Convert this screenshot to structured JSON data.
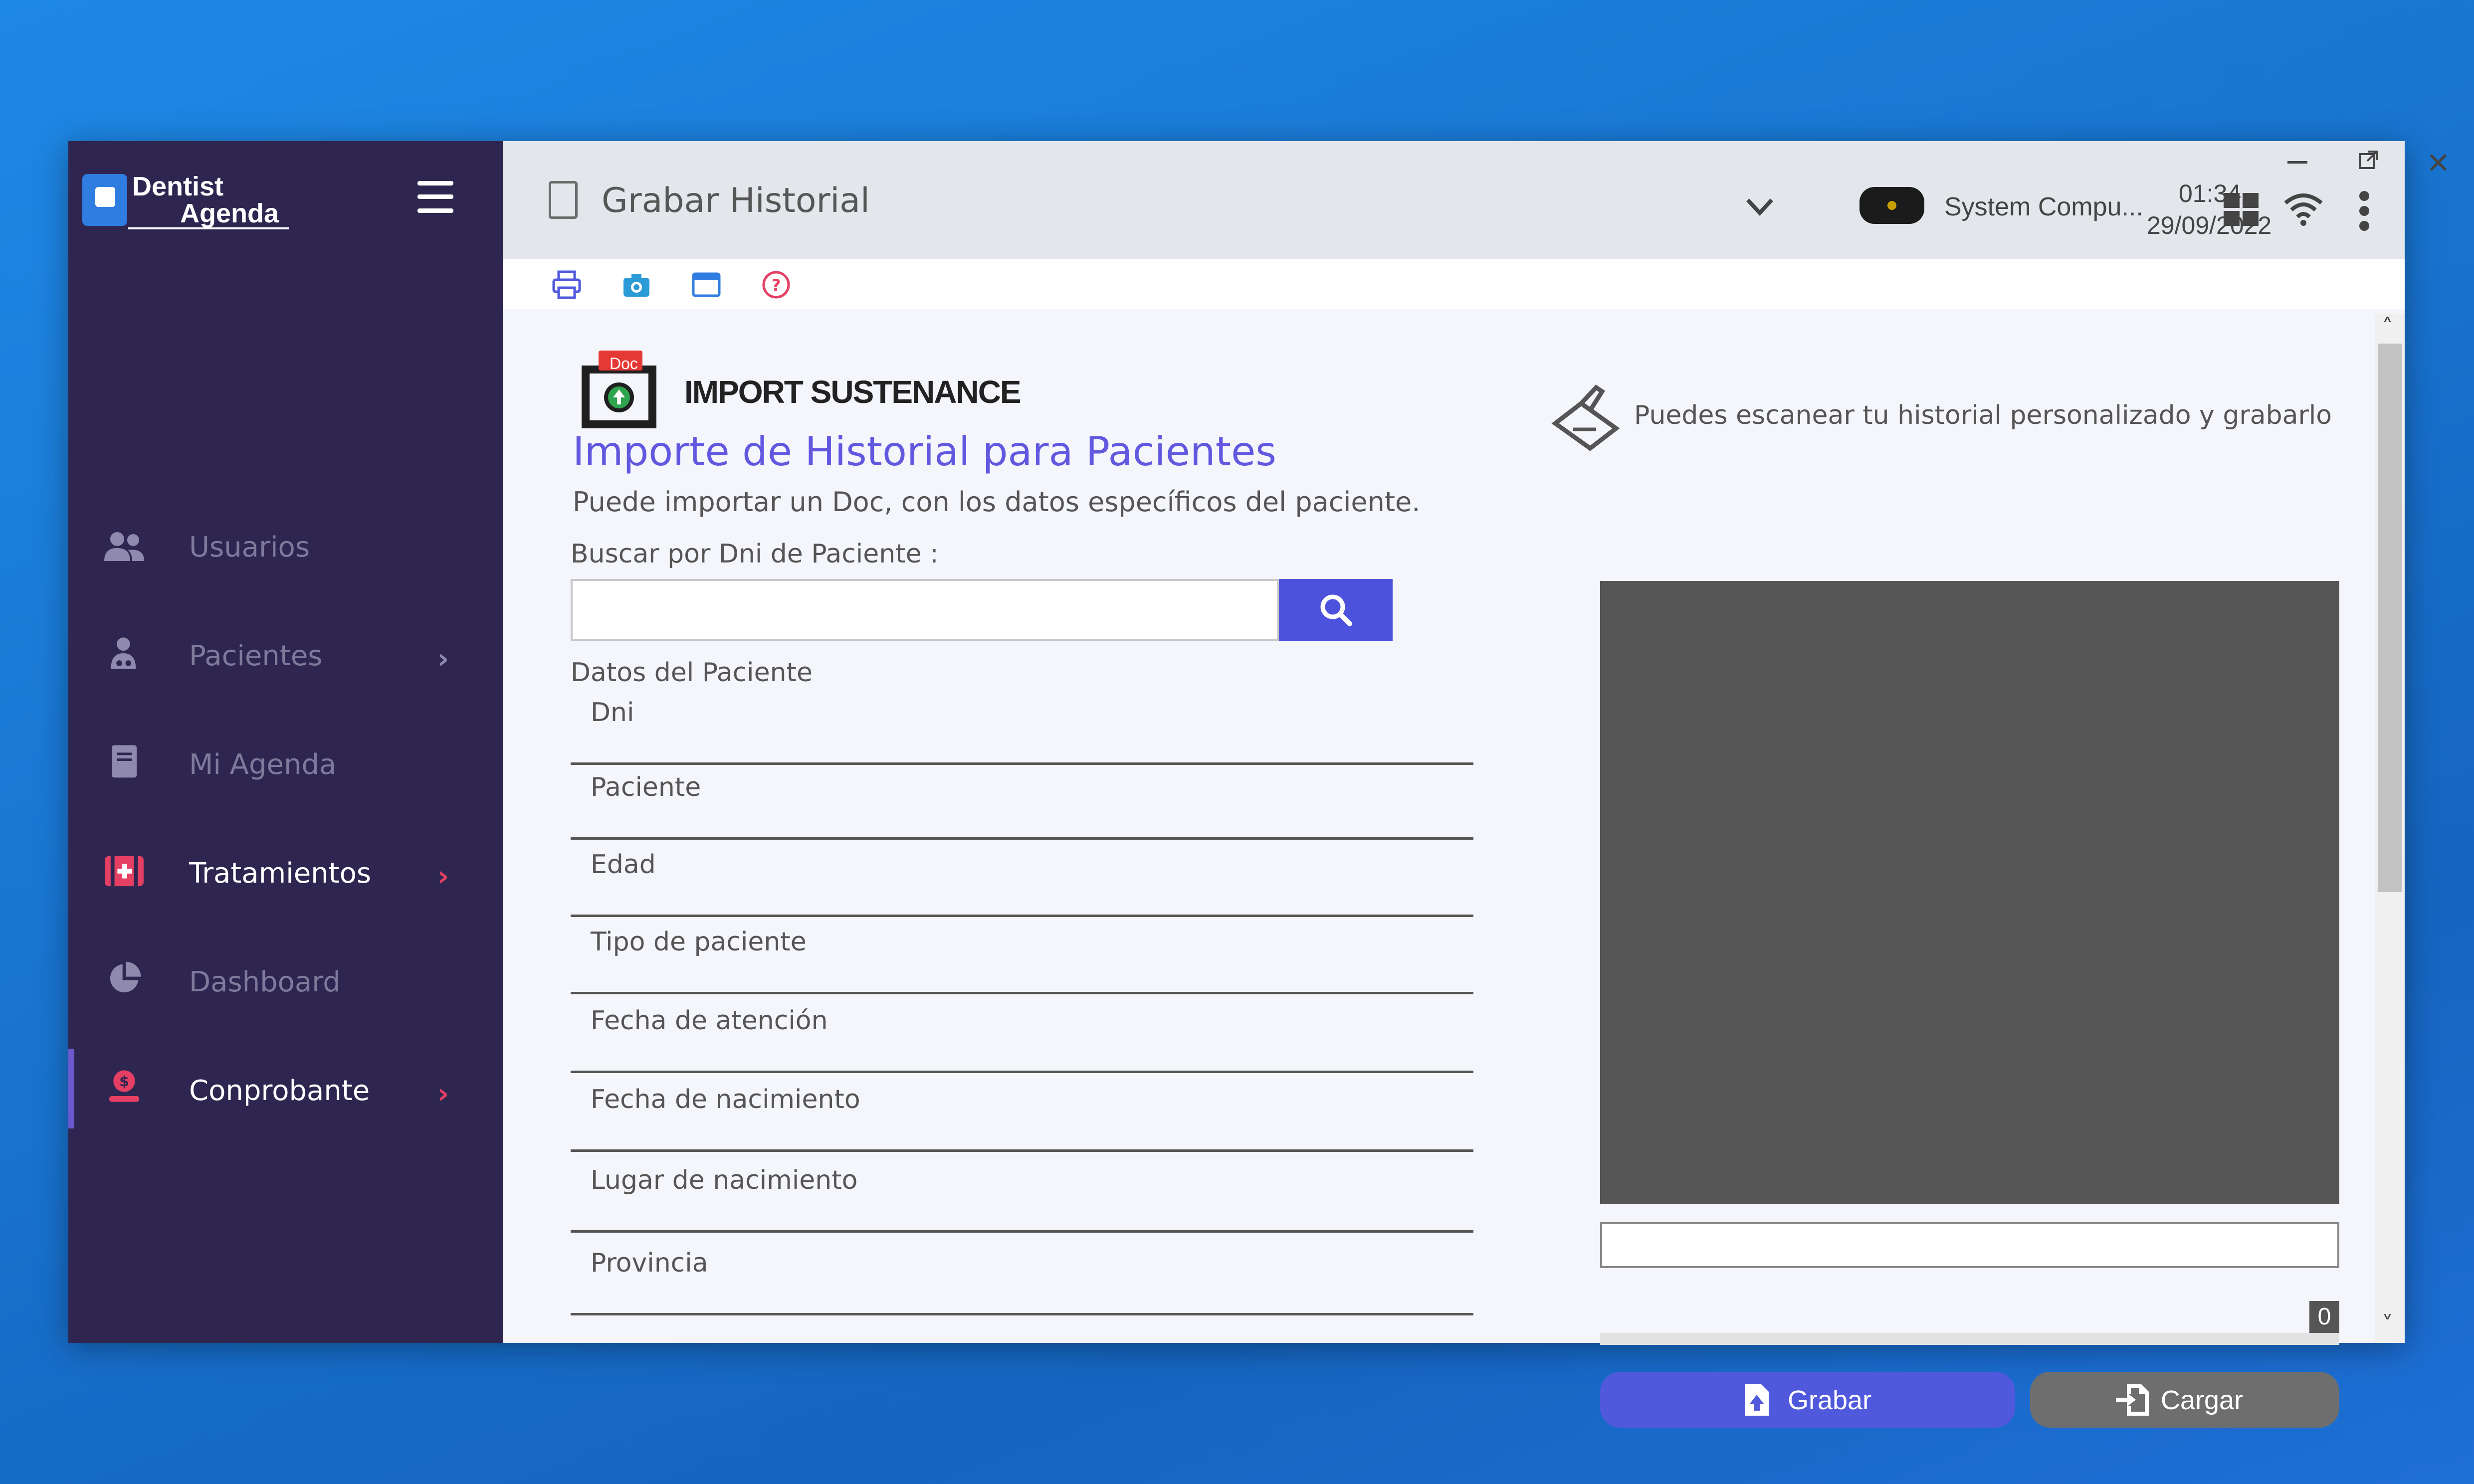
{
  "app": {
    "logo_line1": "Dentist",
    "logo_line2": "Agenda"
  },
  "sidebar": {
    "items": [
      {
        "label": "Usuarios",
        "icon": "users-icon"
      },
      {
        "label": "Pacientes",
        "icon": "doctor-icon",
        "has_submenu": true
      },
      {
        "label": "Mi Agenda",
        "icon": "book-icon"
      },
      {
        "label": "Tratamientos",
        "icon": "medical-kit-icon",
        "has_submenu": true
      },
      {
        "label": "Dashboard",
        "icon": "pie-chart-icon"
      },
      {
        "label": "Conprobante",
        "icon": "money-hand-icon",
        "has_submenu": true,
        "active": true
      }
    ]
  },
  "titlebar": {
    "title": "Grabar Historial",
    "system_name": "System Compu...",
    "time": "01:34",
    "date": "29/09/2022"
  },
  "main": {
    "import_badge_text": "Doc",
    "import_title": "IMPORT SUSTENANCE",
    "heading": "Importe de Historial para Pacientes",
    "subheading": "Puede importar un Doc, con los datos específicos del paciente.",
    "search_label": "Buscar por Dni de Paciente :",
    "search_value": "",
    "section_label": "Datos del Paciente",
    "fields": [
      "Dni",
      "Paciente",
      "Edad",
      "Tipo de paciente",
      "Fecha de atención",
      "Fecha de nacimiento",
      "Lugar de nacimiento",
      "Provincia"
    ],
    "scan_text": "Puedes escanear tu historial personalizado y grabarlo",
    "file_path": "",
    "progress_count": "0",
    "progress_fraction": 0,
    "btn_grabar": "Grabar",
    "btn_cargar": "Cargar"
  },
  "colors": {
    "sidebar_bg": "#2e2650",
    "accent": "#5058dc",
    "accent_pink": "#e54063",
    "heading": "#6258e0"
  }
}
